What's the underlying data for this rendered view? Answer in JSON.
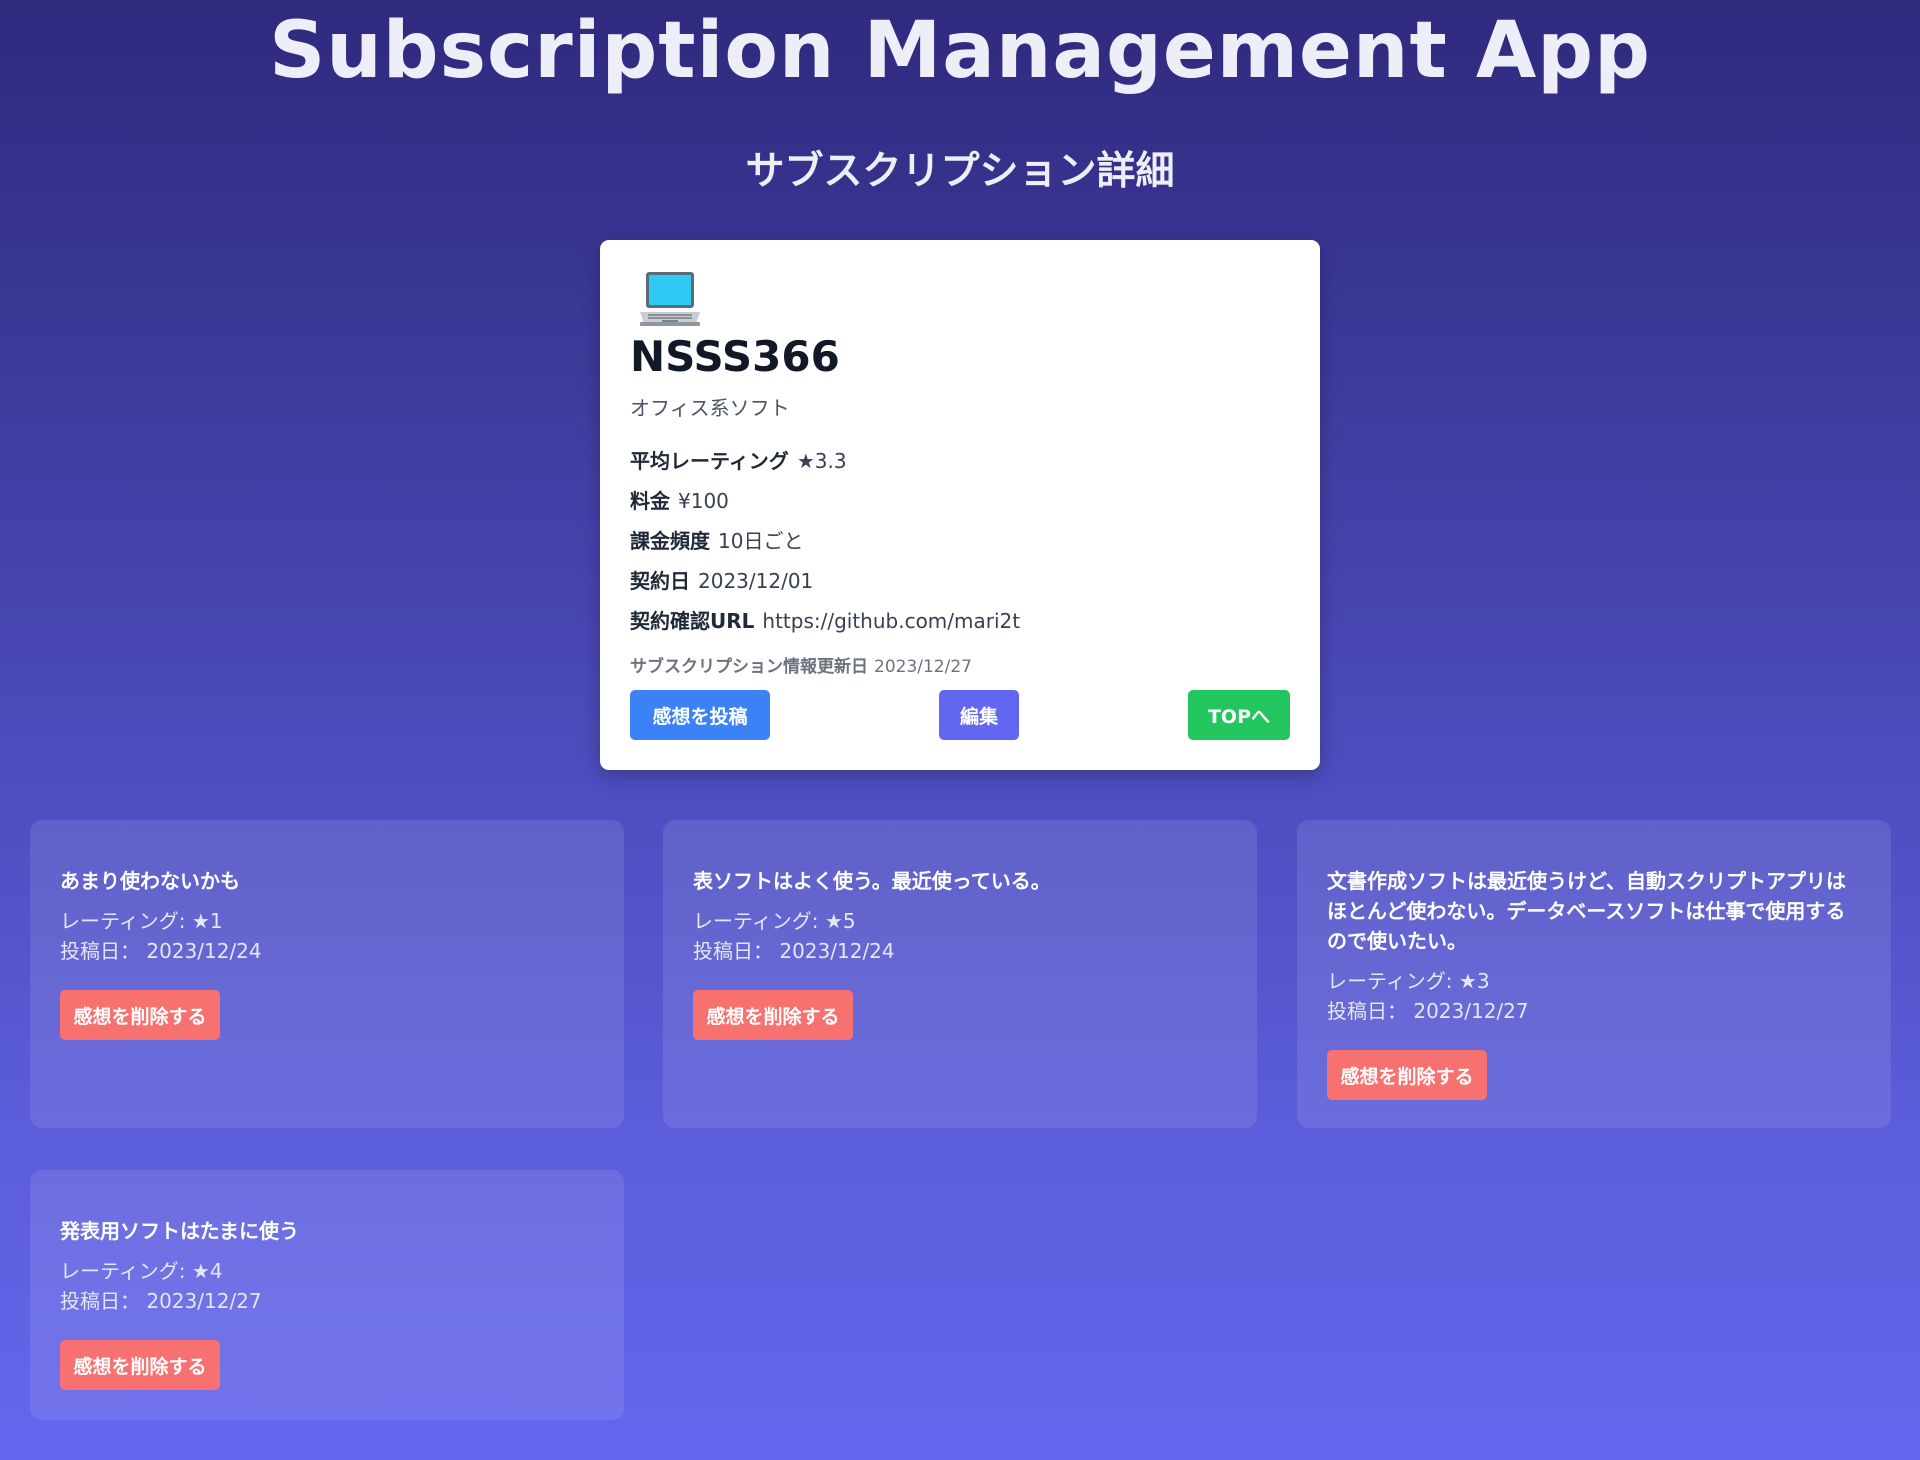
{
  "app": {
    "title": "Subscription Management App",
    "subtitle": "サブスクリプション詳細"
  },
  "subscription": {
    "icon": "laptop-icon",
    "name": "NSSS366",
    "category": "オフィス系ソフト",
    "rating_label": "平均レーティング",
    "rating_value": "★3.3",
    "price_label": "料金",
    "price_value": "¥100",
    "frequency_label": "課金頻度",
    "frequency_value": "10日ごと",
    "contract_label": "契約日",
    "contract_value": "2023/12/01",
    "url_label": "契約確認URL",
    "url_value": "https://github.com/mari2t",
    "updated_label": "サブスクリプション情報更新日",
    "updated_value": "2023/12/27"
  },
  "buttons": {
    "post_review": "感想を投稿",
    "edit": "編集",
    "top": "TOPへ",
    "delete_review": "感想を削除する"
  },
  "reviews": [
    {
      "text": "あまり使わないかも",
      "rating": "レーティング: ★1",
      "date": "投稿日： 2023/12/24"
    },
    {
      "text": "表ソフトはよく使う。最近使っている。",
      "rating": "レーティング: ★5",
      "date": "投稿日： 2023/12/24"
    },
    {
      "text": "文書作成ソフトは最近使うけど、自動スクリプトアプリはほとんど使わない。データベースソフトは仕事で使用するので使いたい。",
      "rating": "レーティング: ★3",
      "date": "投稿日： 2023/12/27"
    },
    {
      "text": "発表用ソフトはたまに使う",
      "rating": "レーティング: ★4",
      "date": "投稿日： 2023/12/27"
    }
  ],
  "colors": {
    "post_button": "#3b82f6",
    "edit_button": "#6366f1",
    "top_button": "#22c55e",
    "delete_button": "#f87171"
  }
}
